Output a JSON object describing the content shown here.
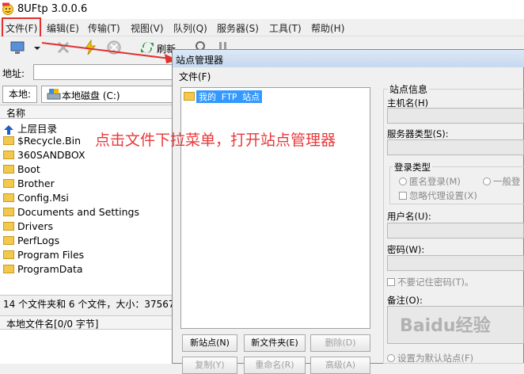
{
  "app": {
    "title": "8UFtp 3.0.0.6"
  },
  "menu": [
    "文件(F)",
    "编辑(E)",
    "传输(T)",
    "视图(V)",
    "队列(Q)",
    "服务器(S)",
    "工具(T)",
    "帮助(H)"
  ],
  "toolbar": {
    "refresh_label": "刷新"
  },
  "address": {
    "label": "地址:",
    "value": ""
  },
  "local": {
    "tab_label": "本地:",
    "disk_label": "本地磁盘 (C:)",
    "column_name": "名称",
    "items": [
      "上层目录",
      "$Recycle.Bin",
      "360SANDBOX",
      "Boot",
      "Brother",
      "Config.Msi",
      "Documents and Settings",
      "Drivers",
      "PerfLogs",
      "Program Files",
      "ProgramData"
    ],
    "status": "14 个文件夹和 6 个文件，大小：37567"
  },
  "queue": {
    "column": "本地文件名[0/0 字节]"
  },
  "site_manager": {
    "title": "站点管理器",
    "menu_file": "文件(F)",
    "tree_item": "我的 FTP 站点",
    "buttons": {
      "new_site": "新站点(N)",
      "new_folder": "新文件夹(E)",
      "delete": "删除(D)",
      "copy": "复制(Y)",
      "rename": "重命名(R)",
      "advanced": "高级(A)"
    },
    "info": {
      "group_title": "站点信息",
      "host_label": "主机名(H)",
      "server_type_label": "服务器类型(S):",
      "login_type_label": "登录类型",
      "anonymous": "匿名登录(M)",
      "normal": "一般登",
      "ignore_proxy": "忽略代理设置(X)",
      "username_label": "用户名(U):",
      "password_label": "密码(W):",
      "no_remember": "不要记住密码(T)。",
      "notes_label": "备注(O):",
      "default_site": "设置为默认站点(F)"
    }
  },
  "annotation": "点击文件下拉菜单，打开站点管理器",
  "watermark": "Baidu经验",
  "colors": {
    "annotation": "#e8383a",
    "selection": "#3399ff",
    "folder": "#f2c94c"
  }
}
